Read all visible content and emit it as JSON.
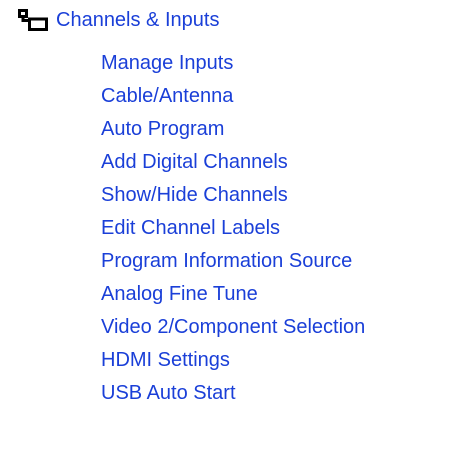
{
  "tree": {
    "root": {
      "label": "Channels & Inputs",
      "icon": "folder-tree-icon"
    },
    "items": [
      {
        "label": "Manage Inputs"
      },
      {
        "label": "Cable/Antenna"
      },
      {
        "label": "Auto Program"
      },
      {
        "label": "Add Digital Channels"
      },
      {
        "label": "Show/Hide Channels"
      },
      {
        "label": "Edit Channel Labels"
      },
      {
        "label": "Program Information Source"
      },
      {
        "label": "Analog Fine Tune"
      },
      {
        "label": "Video 2/Component Selection"
      },
      {
        "label": "HDMI Settings"
      },
      {
        "label": "USB Auto Start"
      }
    ]
  },
  "colors": {
    "link": "#1a3fd8",
    "icon": "#000000",
    "background": "#ffffff"
  }
}
